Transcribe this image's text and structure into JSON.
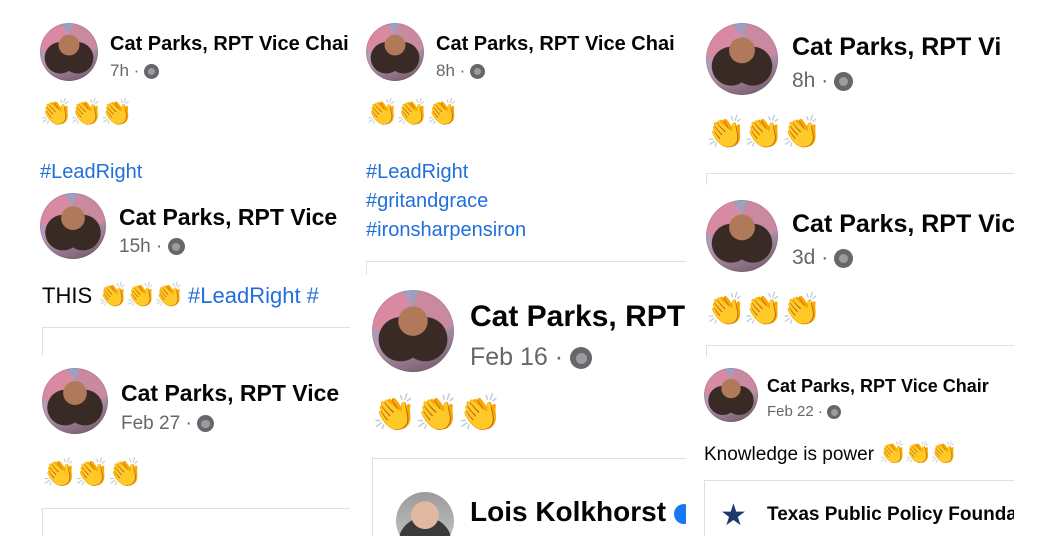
{
  "colors": {
    "link": "#216fdb",
    "meta": "#65676b",
    "text": "#050505"
  },
  "posts": [
    {
      "name": "Cat Parks, RPT Vice Chai",
      "time": "7h",
      "text": "",
      "claps": "👏👏👏",
      "tags": [
        "#LeadRight"
      ]
    },
    {
      "name": "Cat Parks, RPT Vice Chai",
      "time": "8h",
      "text": "",
      "claps": "👏👏👏",
      "tags": [
        "#LeadRight",
        "#gritandgrace",
        "#ironsharpensiron"
      ]
    },
    {
      "name": "Cat Parks, RPT Vi",
      "time": "8h",
      "text": "",
      "claps": "👏👏👏",
      "tags": []
    },
    {
      "name": "Cat Parks, RPT Vice",
      "time": "15h",
      "text": "THIS",
      "claps": "👏👏👏",
      "tags": [
        "#LeadRight #"
      ]
    },
    {
      "name": "Cat Parks, RPT Vic",
      "time": "3d",
      "text": "",
      "claps": "👏👏👏",
      "tags": []
    },
    {
      "name": "Cat Parks, RPT",
      "time": "Feb 16",
      "text": "",
      "claps": "👏👏👏",
      "tags": [],
      "shared_name": "Lois Kolkhorst"
    },
    {
      "name": "Cat Parks, RPT Vice",
      "time": "Feb 27",
      "text": "",
      "claps": "👏👏👏",
      "tags": []
    },
    {
      "name": "Cat Parks, RPT Vice Chair",
      "time": "Feb 22",
      "text": "Knowledge is power",
      "claps": "👏👏👏",
      "tags": [],
      "shared_name": "Texas Public Policy Founda"
    }
  ],
  "separator": "·"
}
